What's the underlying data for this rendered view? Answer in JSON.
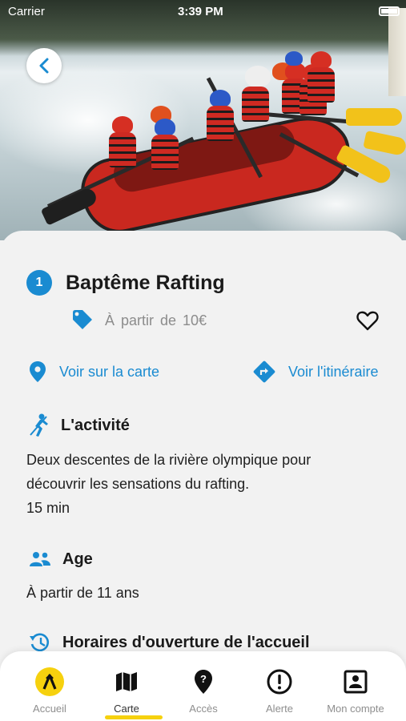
{
  "status_bar": {
    "carrier": "Carrier",
    "time": "3:39 PM"
  },
  "activity": {
    "number": "1",
    "title": "Baptême Rafting",
    "price": "À  partir de 10€"
  },
  "links": {
    "map": "Voir sur la carte",
    "route": "Voir l'itinéraire"
  },
  "sections": {
    "activity_heading": "L'activité",
    "activity_line1": "Deux descentes de la rivière olympique pour",
    "activity_line2": "découvrir les sensations du rafting.",
    "activity_duration": "15 min",
    "age_heading": "Age",
    "age_text": "À partir de 11 ans",
    "hours_heading": "Horaires d'ouverture de l'accueil"
  },
  "tabs": [
    {
      "label": "Accueil",
      "icon": "home-logo-icon"
    },
    {
      "label": "Carte",
      "icon": "map-icon"
    },
    {
      "label": "Accès",
      "icon": "location-pin-icon"
    },
    {
      "label": "Alerte",
      "icon": "alert-icon"
    },
    {
      "label": "Mon compte",
      "icon": "account-icon"
    }
  ],
  "active_tab": "Carte",
  "colors": {
    "accent": "#1a8bd1",
    "active_underline": "#f6d10e",
    "logo_yellow": "#f6d10e"
  }
}
